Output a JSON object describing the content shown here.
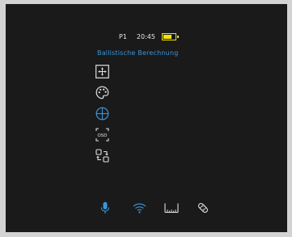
{
  "status": {
    "profile": "P1",
    "time": "20:45",
    "battery_level": 0.7
  },
  "menu": {
    "title": "Ballistische Berechnung",
    "items": [
      {
        "icon": "reticle-frame-icon"
      },
      {
        "icon": "palette-icon"
      },
      {
        "icon": "crosshair-icon",
        "active": true
      },
      {
        "icon": "osd-icon"
      },
      {
        "icon": "switch-icon"
      }
    ]
  },
  "bottom_bar": {
    "icons": [
      "microphone-icon",
      "wifi-icon",
      "ruler-icon",
      "bandage-icon"
    ]
  },
  "colors": {
    "accent": "#3b95d9",
    "battery": "#f2e400",
    "text": "#e8e8e8",
    "icon": "#e0e0e0",
    "background": "#1a1a1a"
  }
}
